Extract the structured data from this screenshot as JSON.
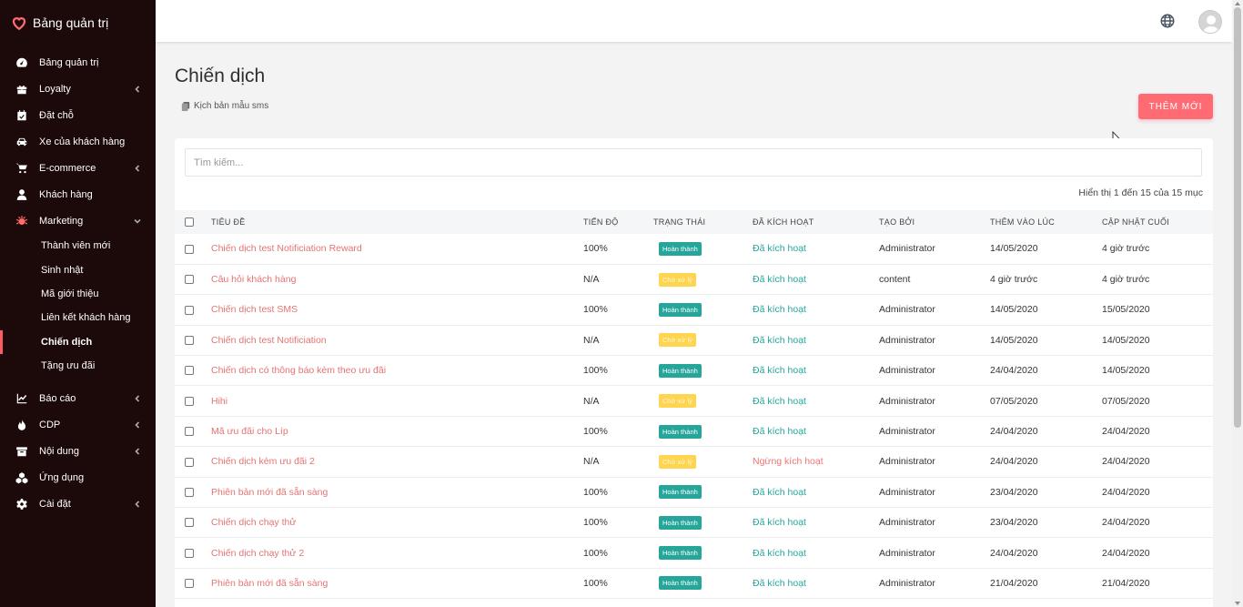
{
  "colors": {
    "sidebar_bg": "#1c0a0a",
    "accent": "#ff6b72",
    "done": "#26a69a",
    "pending": "#ffd54f",
    "link": "#e57373"
  },
  "brand": {
    "title": "Bảng quản trị",
    "icon": "heart-icon"
  },
  "sidebar": {
    "items": [
      {
        "label": "Bảng quản trị",
        "icon": "dashboard-icon",
        "chevron": false
      },
      {
        "label": "Loyalty",
        "icon": "gift-icon",
        "chevron": true
      },
      {
        "label": "Đặt chỗ",
        "icon": "calendar-icon",
        "chevron": false
      },
      {
        "label": "Xe của khách hàng",
        "icon": "car-icon",
        "chevron": false
      },
      {
        "label": "E-commerce",
        "icon": "cart-icon",
        "chevron": true
      },
      {
        "label": "Khách hàng",
        "icon": "user-icon",
        "chevron": false
      },
      {
        "label": "Marketing",
        "icon": "bug-icon",
        "chevron": "down"
      }
    ],
    "marketing_sub": [
      {
        "label": "Thành viên mới",
        "active": false
      },
      {
        "label": "Sinh nhật",
        "active": false
      },
      {
        "label": "Mã giới thiệu",
        "active": false
      },
      {
        "label": "Liên kết khách hàng",
        "active": false
      },
      {
        "label": "Chiến dịch",
        "active": true
      },
      {
        "label": "Tặng ưu đãi",
        "active": false
      }
    ],
    "items_after": [
      {
        "label": "Báo cáo",
        "icon": "chart-icon",
        "chevron": true
      },
      {
        "label": "CDP",
        "icon": "flame-icon",
        "chevron": true
      },
      {
        "label": "Nội dung",
        "icon": "archive-icon",
        "chevron": true
      },
      {
        "label": "Ứng dụng",
        "icon": "cubes-icon",
        "chevron": false
      },
      {
        "label": "Cài đặt",
        "icon": "gear-icon",
        "chevron": true
      }
    ]
  },
  "page": {
    "title": "Chiến dịch",
    "template_link": "Kịch bản mẫu sms",
    "add_button": "THÊM MỚI"
  },
  "search": {
    "placeholder": "Tìm kiếm..."
  },
  "summary": "Hiển thị 1 đến 15 của 15 mục",
  "table": {
    "headers": [
      "TIÊU ĐỀ",
      "TIẾN ĐỘ",
      "TRẠNG THÁI",
      "ĐÃ KÍCH HOẠT",
      "TẠO BỞI",
      "THÊM VÀO LÚC",
      "CẬP NHẬT CUỐI"
    ],
    "rows": [
      {
        "title": "Chiến dịch test Notificiation Reward",
        "progress": "100%",
        "status": "Hoàn thành",
        "status_type": "done",
        "activation": "Đã kích hoạt",
        "active": true,
        "by": "Administrator",
        "added": "14/05/2020",
        "updated": "4 giờ trước"
      },
      {
        "title": "Câu hỏi khách hàng",
        "progress": "N/A",
        "status": "Chờ xử lý",
        "status_type": "pending",
        "activation": "Đã kích hoạt",
        "active": true,
        "by": "content",
        "added": "4 giờ trước",
        "updated": "4 giờ trước"
      },
      {
        "title": "Chiến dịch test SMS",
        "progress": "100%",
        "status": "Hoàn thành",
        "status_type": "done",
        "activation": "Đã kích hoạt",
        "active": true,
        "by": "Administrator",
        "added": "14/05/2020",
        "updated": "15/05/2020"
      },
      {
        "title": "Chiến dịch test Notificiation",
        "progress": "N/A",
        "status": "Chờ xử lý",
        "status_type": "pending",
        "activation": "Đã kích hoạt",
        "active": true,
        "by": "Administrator",
        "added": "14/05/2020",
        "updated": "14/05/2020"
      },
      {
        "title": "Chiến dịch có thông báo kèm theo ưu đãi",
        "progress": "100%",
        "status": "Hoàn thành",
        "status_type": "done",
        "activation": "Đã kích hoạt",
        "active": true,
        "by": "Administrator",
        "added": "24/04/2020",
        "updated": "14/05/2020"
      },
      {
        "title": "Hihi",
        "progress": "N/A",
        "status": "Chờ xử lý",
        "status_type": "pending",
        "activation": "Đã kích hoạt",
        "active": true,
        "by": "Administrator",
        "added": "07/05/2020",
        "updated": "07/05/2020"
      },
      {
        "title": "Mã ưu đãi cho Líp",
        "progress": "100%",
        "status": "Hoàn thành",
        "status_type": "done",
        "activation": "Đã kích hoạt",
        "active": true,
        "by": "Administrator",
        "added": "24/04/2020",
        "updated": "24/04/2020"
      },
      {
        "title": "Chiến dịch kèm ưu đãi 2",
        "progress": "N/A",
        "status": "Chờ xử lý",
        "status_type": "pending",
        "activation": "Ngừng kích hoạt",
        "active": false,
        "by": "Administrator",
        "added": "24/04/2020",
        "updated": "24/04/2020"
      },
      {
        "title": "Phiên bản mới đã sẵn sàng",
        "progress": "100%",
        "status": "Hoàn thành",
        "status_type": "done",
        "activation": "Đã kích hoạt",
        "active": true,
        "by": "Administrator",
        "added": "23/04/2020",
        "updated": "24/04/2020"
      },
      {
        "title": "Chiến dịch chạy thử",
        "progress": "100%",
        "status": "Hoàn thành",
        "status_type": "done",
        "activation": "Đã kích hoạt",
        "active": true,
        "by": "Administrator",
        "added": "23/04/2020",
        "updated": "24/04/2020"
      },
      {
        "title": "Chiến dịch chạy thử 2",
        "progress": "100%",
        "status": "Hoàn thành",
        "status_type": "done",
        "activation": "Đã kích hoạt",
        "active": true,
        "by": "Administrator",
        "added": "24/04/2020",
        "updated": "24/04/2020"
      },
      {
        "title": "Phiên bản mới đã sẵn sàng",
        "progress": "100%",
        "status": "Hoàn thành",
        "status_type": "done",
        "activation": "Đã kích hoạt",
        "active": true,
        "by": "Administrator",
        "added": "21/04/2020",
        "updated": "21/04/2020"
      }
    ]
  }
}
